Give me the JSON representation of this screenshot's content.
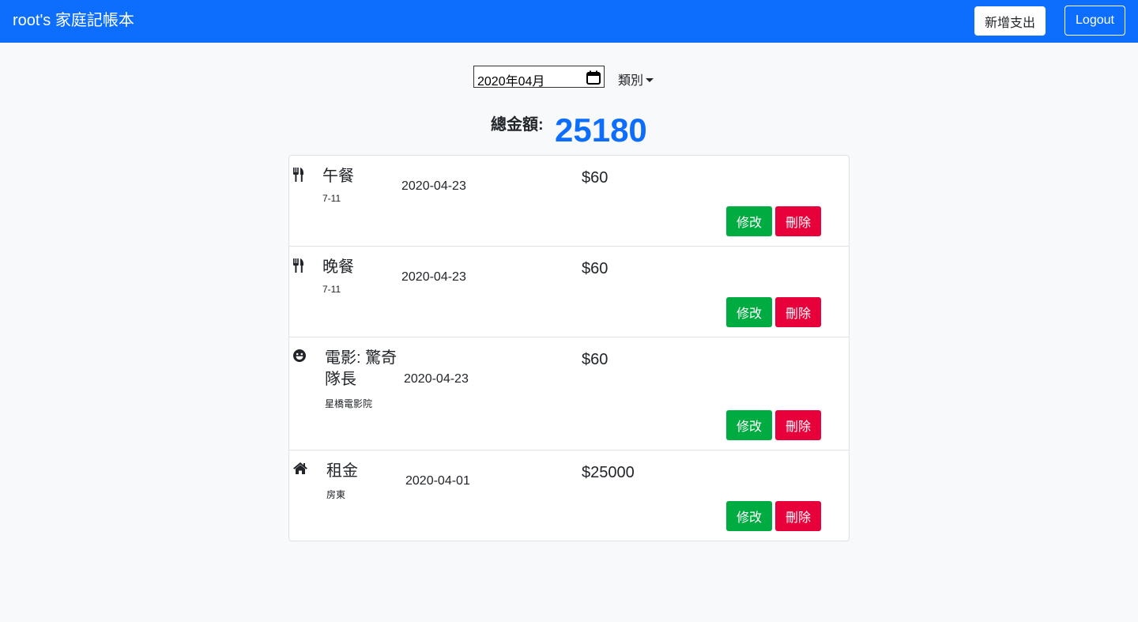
{
  "navbar": {
    "brand": "root's 家庭記帳本",
    "add_label": "新增支出",
    "logout_label": "Logout"
  },
  "filter": {
    "month_value": "2020年04月",
    "category_label": "類別"
  },
  "summary": {
    "total_label": "總金額:",
    "total_value": "25180"
  },
  "records": [
    {
      "icon": "utensils-icon",
      "name": "午餐",
      "merchant": "7-11",
      "date": "2020-04-23",
      "amount": "$60",
      "edit_label": "修改",
      "delete_label": "刪除"
    },
    {
      "icon": "utensils-icon",
      "name": "晚餐",
      "merchant": "7-11",
      "date": "2020-04-23",
      "amount": "$60",
      "edit_label": "修改",
      "delete_label": "刪除"
    },
    {
      "icon": "laugh-icon",
      "name_line1": "電影: 驚奇",
      "name_line2": "隊長",
      "merchant": "星橋電影院",
      "date": "2020-04-23",
      "amount": "$60",
      "edit_label": "修改",
      "delete_label": "刪除"
    },
    {
      "icon": "home-icon",
      "name": "租金",
      "merchant": "房東",
      "date": "2020-04-01",
      "amount": "$25000",
      "edit_label": "修改",
      "delete_label": "刪除"
    }
  ],
  "colors": {
    "primary": "#0d6efd",
    "edit": "#00ab41",
    "delete": "#e8003a"
  }
}
